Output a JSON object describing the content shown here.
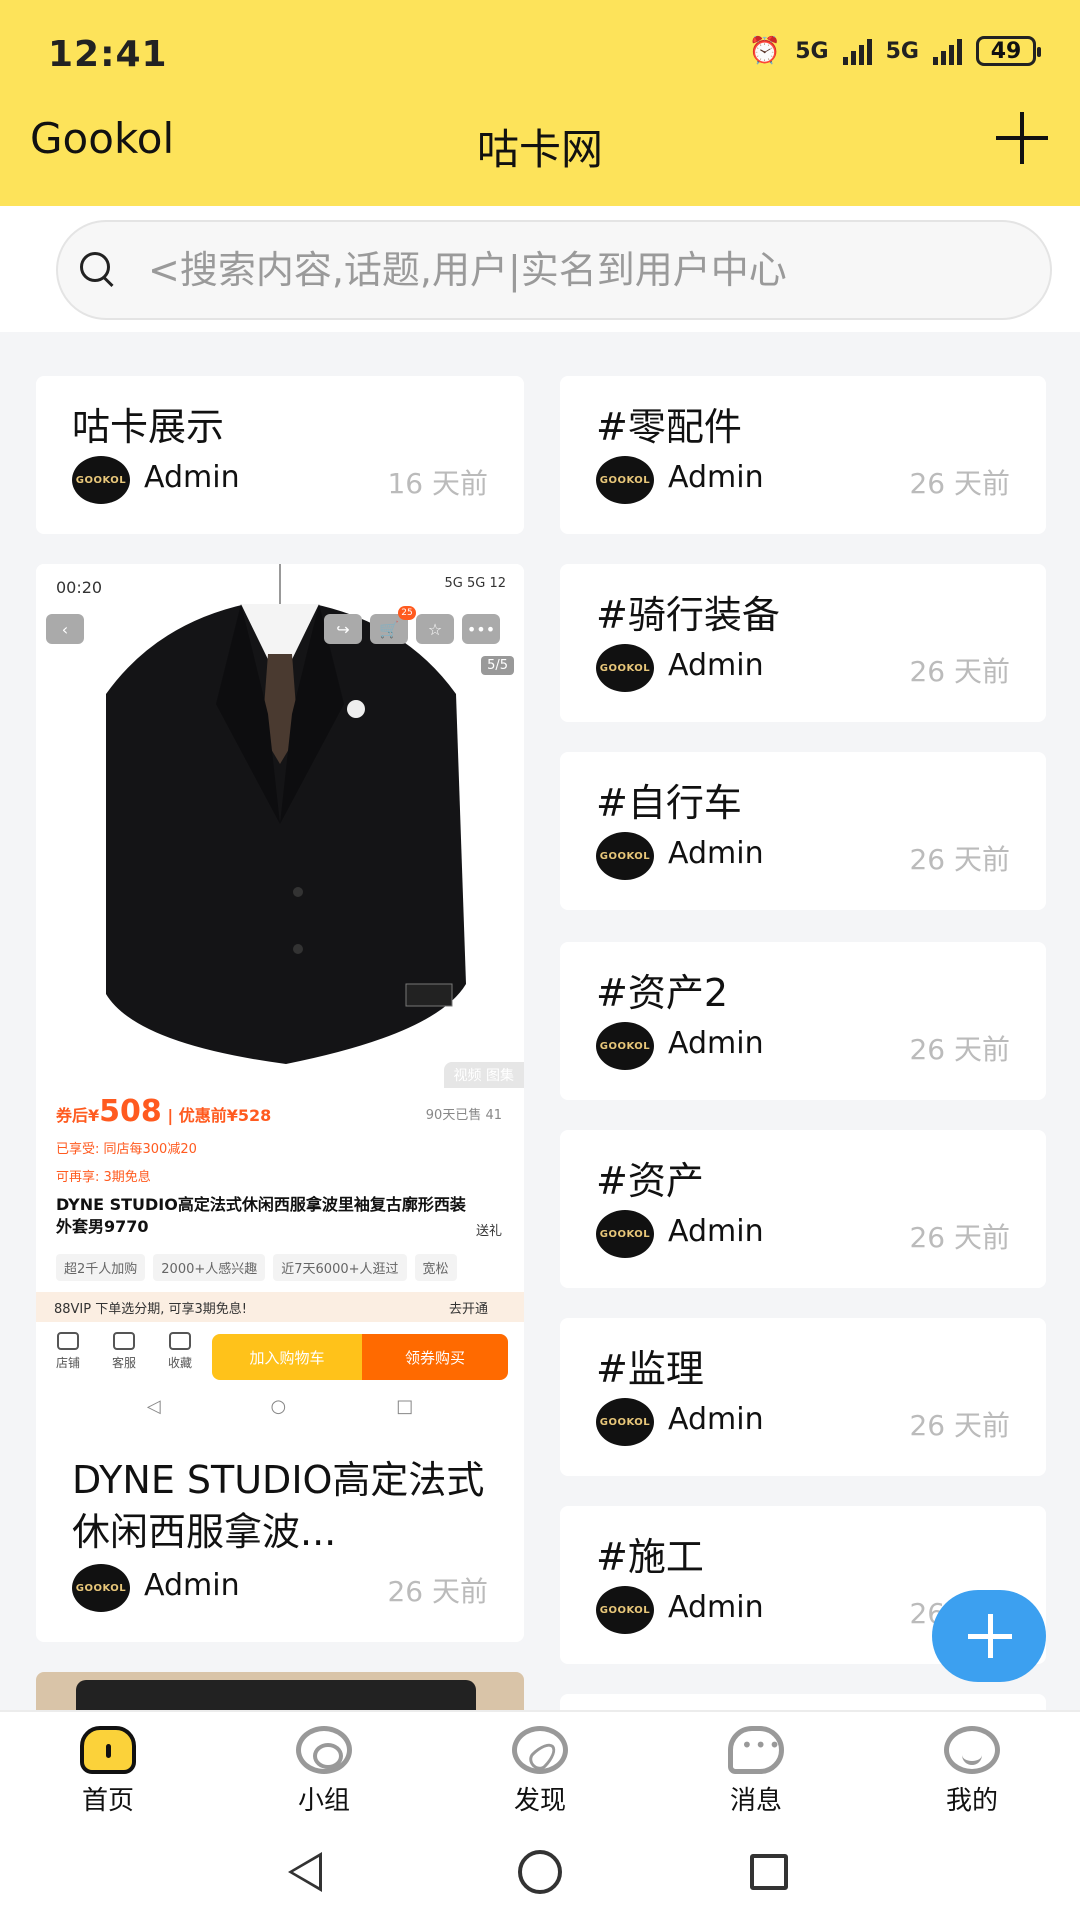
{
  "status_bar": {
    "time": "12:41",
    "network1": "5G",
    "network2": "5G",
    "battery": "49"
  },
  "header": {
    "app_name": "Gookol",
    "title": "咕卡网"
  },
  "search": {
    "placeholder": "<搜索内容,话题,用户|实名到用户中心"
  },
  "avatar_text": "GOOKOL",
  "left_cards": [
    {
      "title": "咕卡展示",
      "author": "Admin",
      "time": "16 天前"
    }
  ],
  "image_card": {
    "title": "DYNE STUDIO高定法式休闲西服拿波...",
    "author": "Admin",
    "time": "26 天前",
    "shot": {
      "time": "00:20",
      "status_right": "5G 5G 12",
      "cart_badge": "25",
      "page_count": "5/5",
      "view_tabs": "视频  图集",
      "price_prefix": "券后¥",
      "price": "508",
      "price_before": "| 优惠前¥528",
      "sold": "90天已售 41",
      "promo1": "已享受: 同店每300减20",
      "promo2": "可再享: 3期免息",
      "product_title": "DYNE STUDIO高定法式休闲西服拿波里袖复古廓形西装外套男9770",
      "gift": "送礼",
      "tags": [
        "超2千人加购",
        "2000+人感兴趣",
        "近7天6000+人逛过",
        "宽松"
      ],
      "vip_text": "88VIP 下单选分期, 可享3期免息!",
      "vip_open": "去开通",
      "icons": [
        "店铺",
        "客服",
        "收藏"
      ],
      "cart_button": "加入购物车",
      "buy_button": "领券购买"
    }
  },
  "right_cards": [
    {
      "title": "#零配件",
      "author": "Admin",
      "time": "26 天前"
    },
    {
      "title": "#骑行装备",
      "author": "Admin",
      "time": "26 天前"
    },
    {
      "title": "#自行车",
      "author": "Admin",
      "time": "26 天前"
    },
    {
      "title": "#资产2",
      "author": "Admin",
      "time": "26 天前"
    },
    {
      "title": "#资产",
      "author": "Admin",
      "time": "26 天前"
    },
    {
      "title": "#监理",
      "author": "Admin",
      "time": "26 天前"
    },
    {
      "title": "#施工",
      "author": "Admin",
      "time": "26 天前"
    }
  ],
  "tabbar": {
    "tabs": [
      {
        "label": "首页",
        "icon": "home-icon",
        "active": true
      },
      {
        "label": "小组",
        "icon": "group-icon"
      },
      {
        "label": "发现",
        "icon": "compass-icon"
      },
      {
        "label": "消息",
        "icon": "message-icon"
      },
      {
        "label": "我的",
        "icon": "profile-icon"
      }
    ]
  },
  "colors": {
    "header_bg": "#fde35a",
    "fab": "#3ca0f0",
    "accent_orange": "#ff6a00"
  }
}
